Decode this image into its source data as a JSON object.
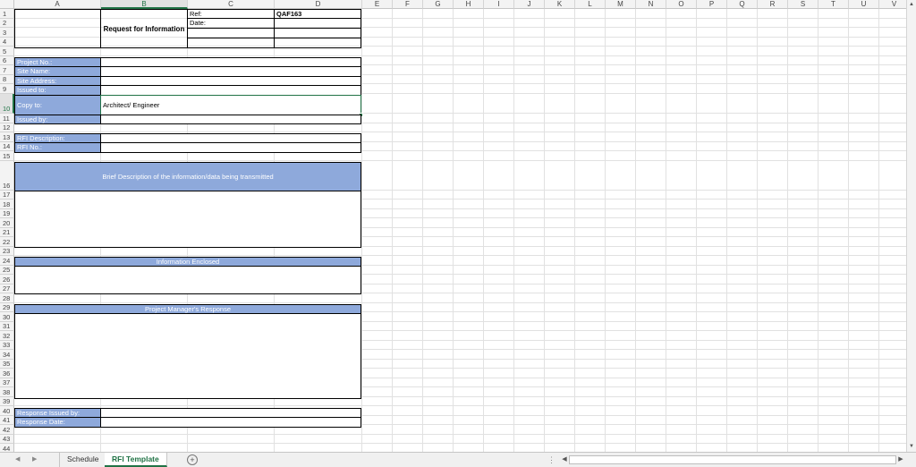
{
  "columns": [
    "A",
    "B",
    "C",
    "D",
    "E",
    "F",
    "G",
    "H",
    "I",
    "J",
    "K",
    "L",
    "M",
    "N",
    "O",
    "P",
    "Q",
    "R",
    "S",
    "T",
    "U",
    "V"
  ],
  "rows": [
    "1",
    "2",
    "3",
    "4",
    "5",
    "6",
    "7",
    "8",
    "9",
    "10",
    "11",
    "12",
    "13",
    "14",
    "15",
    "16",
    "17",
    "18",
    "19",
    "20",
    "21",
    "22",
    "23",
    "24",
    "25",
    "26",
    "27",
    "28",
    "29",
    "30",
    "31",
    "32",
    "33",
    "34",
    "35",
    "36",
    "37",
    "38",
    "39",
    "40",
    "41",
    "42",
    "43",
    "44"
  ],
  "form": {
    "title": "Request for Information",
    "ref_label": "Ref:",
    "ref_value": "QAF163",
    "date_label": "Date:",
    "project_no": "Project No.:",
    "site_name": "Site Name:",
    "site_address": "Site Address:",
    "issued_to": "Issued to:",
    "copy_to": "Copy to:",
    "copy_to_value": "Architect/ Engineer",
    "issued_by": "Issued by:",
    "rfi_description": "RFI Description:",
    "rfi_no": "RFI No.:",
    "brief_description": "Brief Description of the information/data being transmitted",
    "information_enclosed": "Information Enclosed",
    "pm_response": "Project Manager's Response",
    "response_issued_by": "Response Issued by:",
    "response_date": "Response Date:"
  },
  "tabs": {
    "sheet1": "Schedule",
    "sheet2": "RFI Template",
    "add": "+"
  },
  "selection": {
    "active_cell": "B10",
    "active_column": "B",
    "active_row": "10"
  },
  "colors": {
    "accent": "#217346",
    "header_fill": "#8ea9db"
  },
  "icons": {
    "nav_left": "triangle-left-icon",
    "nav_right": "triangle-right-icon",
    "add_sheet": "plus-circle-icon"
  }
}
